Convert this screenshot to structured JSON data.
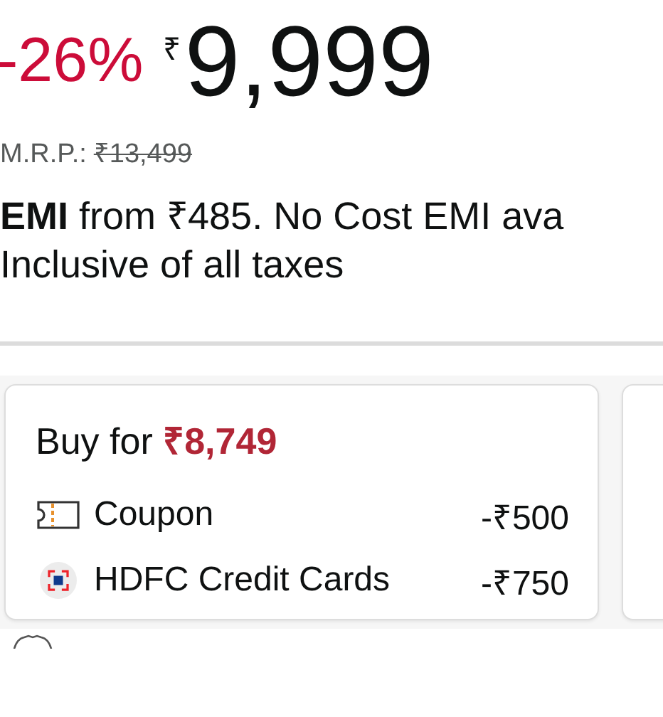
{
  "price": {
    "discount": "-26%",
    "currency": "₹",
    "amount": "9,999"
  },
  "mrp": {
    "label": "M.R.P.:",
    "value": "₹13,499"
  },
  "emi": "**EMI** from ₹485. No Cost EMI ava",
  "tax_note": "Inclusive of all taxes",
  "offer_cards": [
    {
      "title": "Buy for",
      "price": "₹8,749",
      "lines": [
        {
          "kind": "coupon",
          "label": "Coupon",
          "amount": "-₹500"
        },
        {
          "kind": "bank",
          "label": "HDFC Credit Cards",
          "amount": "-₹750"
        }
      ]
    }
  ]
}
